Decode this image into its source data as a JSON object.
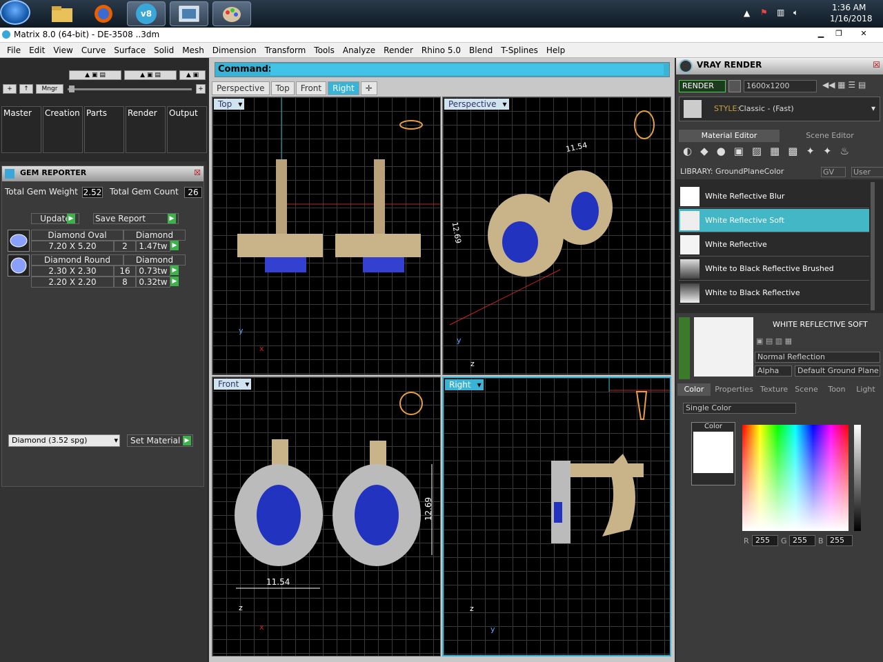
{
  "taskbar": {
    "time": "1:36 AM",
    "date": "1/16/2018",
    "v8_label": "v8"
  },
  "window": {
    "title": "Matrix 8.0 (64-bit) - DE-3508 ..3dm"
  },
  "menu": [
    "File",
    "Edit",
    "View",
    "Curve",
    "Surface",
    "Solid",
    "Mesh",
    "Dimension",
    "Transform",
    "Tools",
    "Analyze",
    "Render",
    "Rhino 5.0",
    "Blend",
    "T-Splines",
    "Help"
  ],
  "left": {
    "manager_label": "Mngr",
    "categories": [
      "Master",
      "Creation",
      "Parts",
      "Render",
      "Output"
    ],
    "gem_reporter": {
      "title": "GEM REPORTER",
      "total_weight_label": "Total Gem Weight",
      "total_weight": "2.52",
      "total_count_label": "Total Gem Count",
      "total_count": "26",
      "update": "Update",
      "save_report": "Save Report",
      "gems": [
        {
          "name": "Diamond Oval",
          "type": "Diamond",
          "rows": [
            {
              "size": "7.20 X 5.20",
              "qty": "2",
              "tw": "1.47tw"
            }
          ]
        },
        {
          "name": "Diamond Round",
          "type": "Diamond",
          "rows": [
            {
              "size": "2.30 X 2.30",
              "qty": "16",
              "tw": "0.73tw"
            },
            {
              "size": "2.20 X 2.20",
              "qty": "8",
              "tw": "0.32tw"
            }
          ]
        }
      ],
      "material_select": "Diamond     (3.52 spg)",
      "set_material": "Set Material"
    }
  },
  "center": {
    "command_label": "Command:",
    "tabs": [
      "Perspective",
      "Top",
      "Front",
      "Right"
    ],
    "viewports": {
      "top": "Top",
      "perspective": "Perspective",
      "front": "Front",
      "right": "Right"
    },
    "dims": {
      "width": "11.54",
      "height": "12.69"
    },
    "axes": {
      "x": "x",
      "y": "y",
      "z": "z"
    }
  },
  "right": {
    "title": "VRAY RENDER",
    "render": "RENDER",
    "resolution": "1600x1200",
    "style_label": "STYLE:",
    "style_value": "Classic - (Fast)",
    "tab_material": "Material Editor",
    "tab_scene": "Scene Editor",
    "library": "LIBRARY: GroundPlaneColor",
    "gv": "GV",
    "user": "User",
    "materials": [
      "White Reflective Blur",
      "White Reflective Soft",
      "White Reflective",
      "White to Black Reflective Brushed",
      "White to Black Reflective"
    ],
    "selected_name": "WHITE REFLECTIVE SOFT",
    "reflection": "Normal Reflection",
    "alpha": "Alpha",
    "ground": "Default Ground Plane",
    "lower_tabs": [
      "Color",
      "Properties",
      "Texture",
      "Scene",
      "Toon",
      "Light"
    ],
    "color_mode": "Single Color",
    "color_label": "Color",
    "rgb": {
      "r_label": "R",
      "r": "255",
      "g_label": "G",
      "g": "255",
      "b_label": "B",
      "b": "255"
    }
  }
}
